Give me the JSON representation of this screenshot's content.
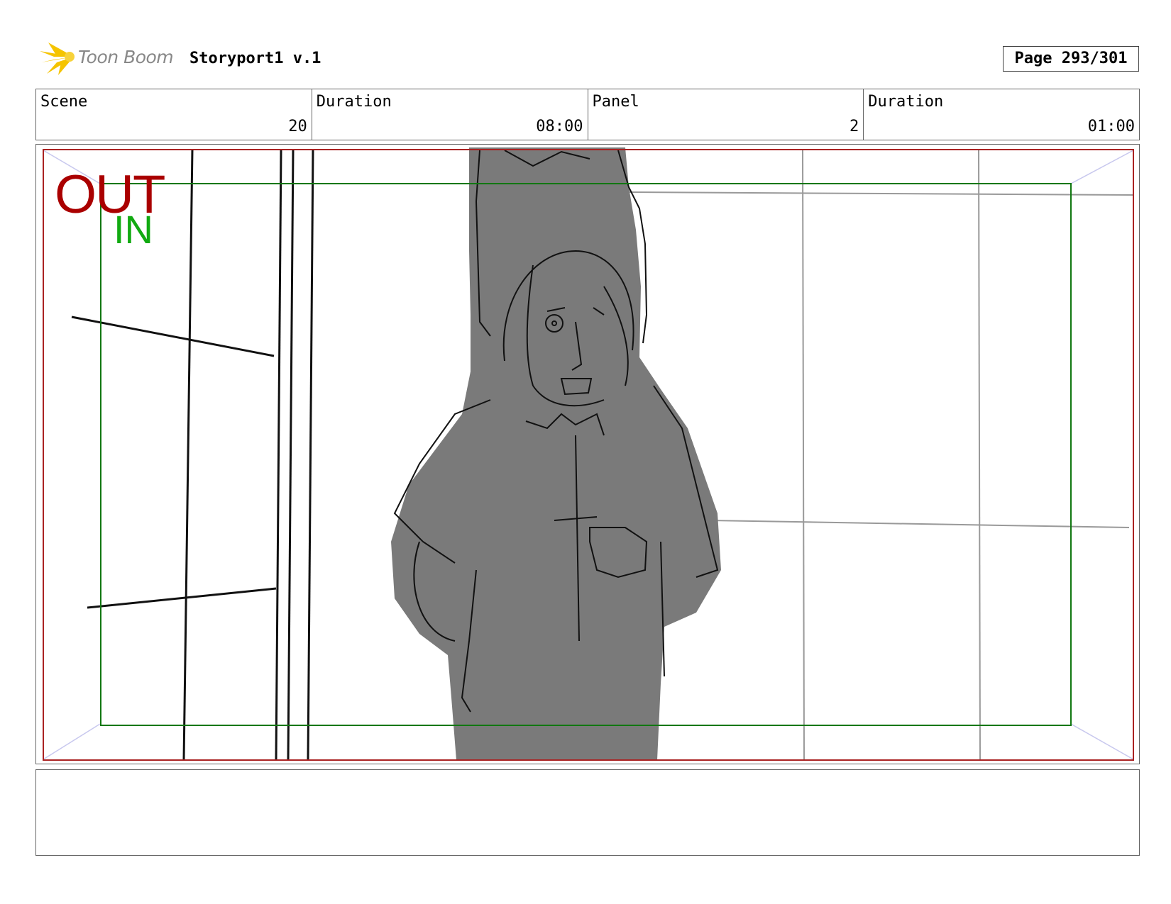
{
  "header": {
    "brand": "Toon Boom",
    "project_title": "Storyport1 v.1",
    "page_label": "Page 293/301"
  },
  "info": {
    "scene_label": "Scene",
    "scene_value": "20",
    "scene_duration_label": "Duration",
    "scene_duration_value": "08:00",
    "panel_label": "Panel",
    "panel_value": "2",
    "panel_duration_label": "Duration",
    "panel_duration_value": "01:00"
  },
  "panel": {
    "out_label": "OUT",
    "in_label": "IN",
    "colors": {
      "out_frame": "#aa2222",
      "in_frame": "#117711",
      "figure_fill": "#7a7a7a"
    }
  },
  "notes": {
    "text": ""
  }
}
